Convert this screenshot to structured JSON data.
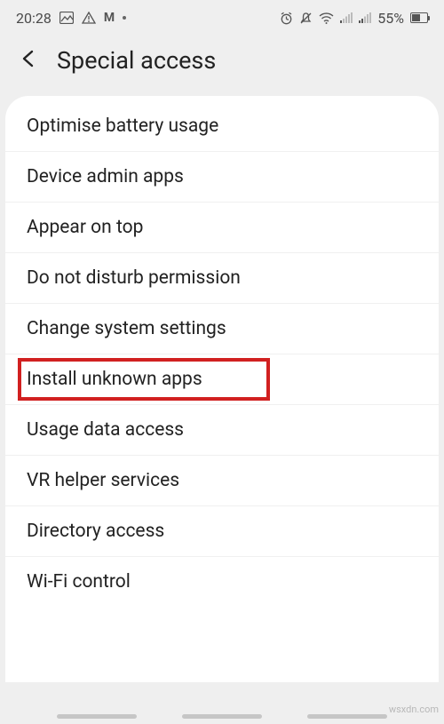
{
  "status": {
    "time": "20:28",
    "battery_pct": "55%"
  },
  "header": {
    "title": "Special access"
  },
  "items": [
    {
      "label": "Optimise battery usage",
      "highlight": false
    },
    {
      "label": "Device admin apps",
      "highlight": false
    },
    {
      "label": "Appear on top",
      "highlight": false
    },
    {
      "label": "Do not disturb permission",
      "highlight": false
    },
    {
      "label": "Change system settings",
      "highlight": false
    },
    {
      "label": "Install unknown apps",
      "highlight": true
    },
    {
      "label": "Usage data access",
      "highlight": false
    },
    {
      "label": "VR helper services",
      "highlight": false
    },
    {
      "label": "Directory access",
      "highlight": false
    },
    {
      "label": "Wi-Fi control",
      "highlight": false
    }
  ],
  "watermark": "wsxdn.com"
}
